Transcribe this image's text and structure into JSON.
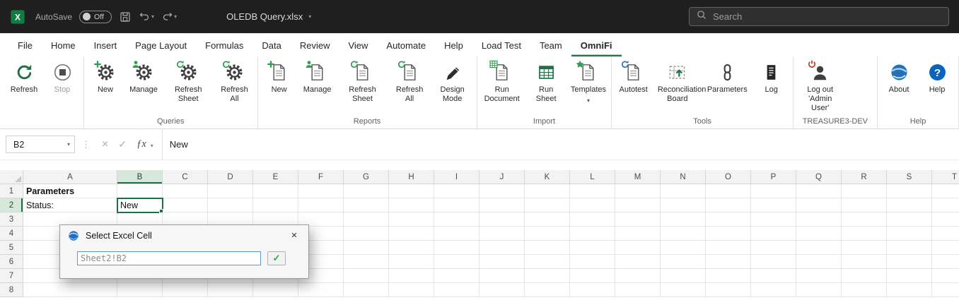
{
  "titlebar": {
    "autosave_label": "AutoSave",
    "autosave_state": "Off",
    "document_title": "OLEDB Query.xlsx",
    "search_placeholder": "Search"
  },
  "glyphs": {
    "chevron_down": "▾",
    "handle_dots": "⋮",
    "cancel": "×",
    "check": "✓",
    "fx": "ƒx"
  },
  "tabs": [
    {
      "label": "File"
    },
    {
      "label": "Home"
    },
    {
      "label": "Insert"
    },
    {
      "label": "Page Layout"
    },
    {
      "label": "Formulas"
    },
    {
      "label": "Data"
    },
    {
      "label": "Review"
    },
    {
      "label": "View"
    },
    {
      "label": "Automate"
    },
    {
      "label": "Help"
    },
    {
      "label": "Load Test"
    },
    {
      "label": "Team"
    },
    {
      "label": "OmniFi",
      "active": true
    }
  ],
  "ribbon": {
    "groups": [
      {
        "caption": "",
        "buttons": [
          {
            "label": "Refresh",
            "icon": "refresh"
          },
          {
            "label": "Stop",
            "icon": "stop",
            "disabled": true
          }
        ]
      },
      {
        "caption": "Queries",
        "buttons": [
          {
            "label": "New",
            "icon": "gear",
            "badge": "plus"
          },
          {
            "label": "Manage",
            "icon": "gear",
            "badge": "person"
          },
          {
            "label": "Refresh Sheet",
            "icon": "gear",
            "badge": "refresh"
          },
          {
            "label": "Refresh All",
            "icon": "gear",
            "badge": "refresh",
            "narrow": true
          }
        ]
      },
      {
        "caption": "Reports",
        "buttons": [
          {
            "label": "New",
            "icon": "doc",
            "badge": "plus"
          },
          {
            "label": "Manage",
            "icon": "doc",
            "badge": "person"
          },
          {
            "label": "Refresh Sheet",
            "icon": "doc",
            "badge": "refresh"
          },
          {
            "label": "Refresh All",
            "icon": "doc",
            "badge": "refresh",
            "narrow": true
          },
          {
            "label": "Design Mode",
            "icon": "pencil",
            "narrow": true
          }
        ]
      },
      {
        "caption": "Import",
        "buttons": [
          {
            "label": "Run Document",
            "icon": "doc",
            "badge": "table",
            "narrow": true
          },
          {
            "label": "Run Sheet",
            "icon": "table",
            "narrow": true
          },
          {
            "label": "Templates",
            "icon": "doc",
            "badge": "star",
            "dropdown": true
          }
        ]
      },
      {
        "caption": "Tools",
        "buttons": [
          {
            "label": "Autotest",
            "icon": "doc",
            "badge": "refresh-blue"
          },
          {
            "label": "Reconciliation Board",
            "icon": "board",
            "narrow": true
          },
          {
            "label": "Parameters",
            "icon": "chain"
          },
          {
            "label": "Log",
            "icon": "log"
          }
        ]
      },
      {
        "caption": "TREASURE3-DEV",
        "buttons": [
          {
            "label": "Log out 'Admin User'",
            "icon": "person",
            "badge": "power",
            "narrow": true
          }
        ]
      },
      {
        "caption": "Help",
        "buttons": [
          {
            "label": "About",
            "icon": "globe"
          },
          {
            "label": "Help",
            "icon": "help"
          }
        ]
      }
    ]
  },
  "formula_bar": {
    "name_box": "B2",
    "formula": "New"
  },
  "grid": {
    "columns": [
      "A",
      "B",
      "C",
      "D",
      "E",
      "F",
      "G",
      "H",
      "I",
      "J",
      "K",
      "L",
      "M",
      "N",
      "O",
      "P",
      "Q",
      "R",
      "S",
      "T"
    ],
    "rows": [
      1,
      2,
      3,
      4,
      5,
      6,
      7,
      8
    ],
    "selected_column": "B",
    "selected_row": 2,
    "selected_cell": "B2",
    "cells": [
      {
        "ref": "A1",
        "text": "Parameters",
        "bold": true
      },
      {
        "ref": "A2",
        "text": "Status:"
      },
      {
        "ref": "B2",
        "text": "New"
      }
    ]
  },
  "dialog": {
    "title": "Select Excel Cell",
    "input_value": "Sheet2!B2",
    "close_glyph": "×",
    "confirm_glyph": "✓"
  }
}
